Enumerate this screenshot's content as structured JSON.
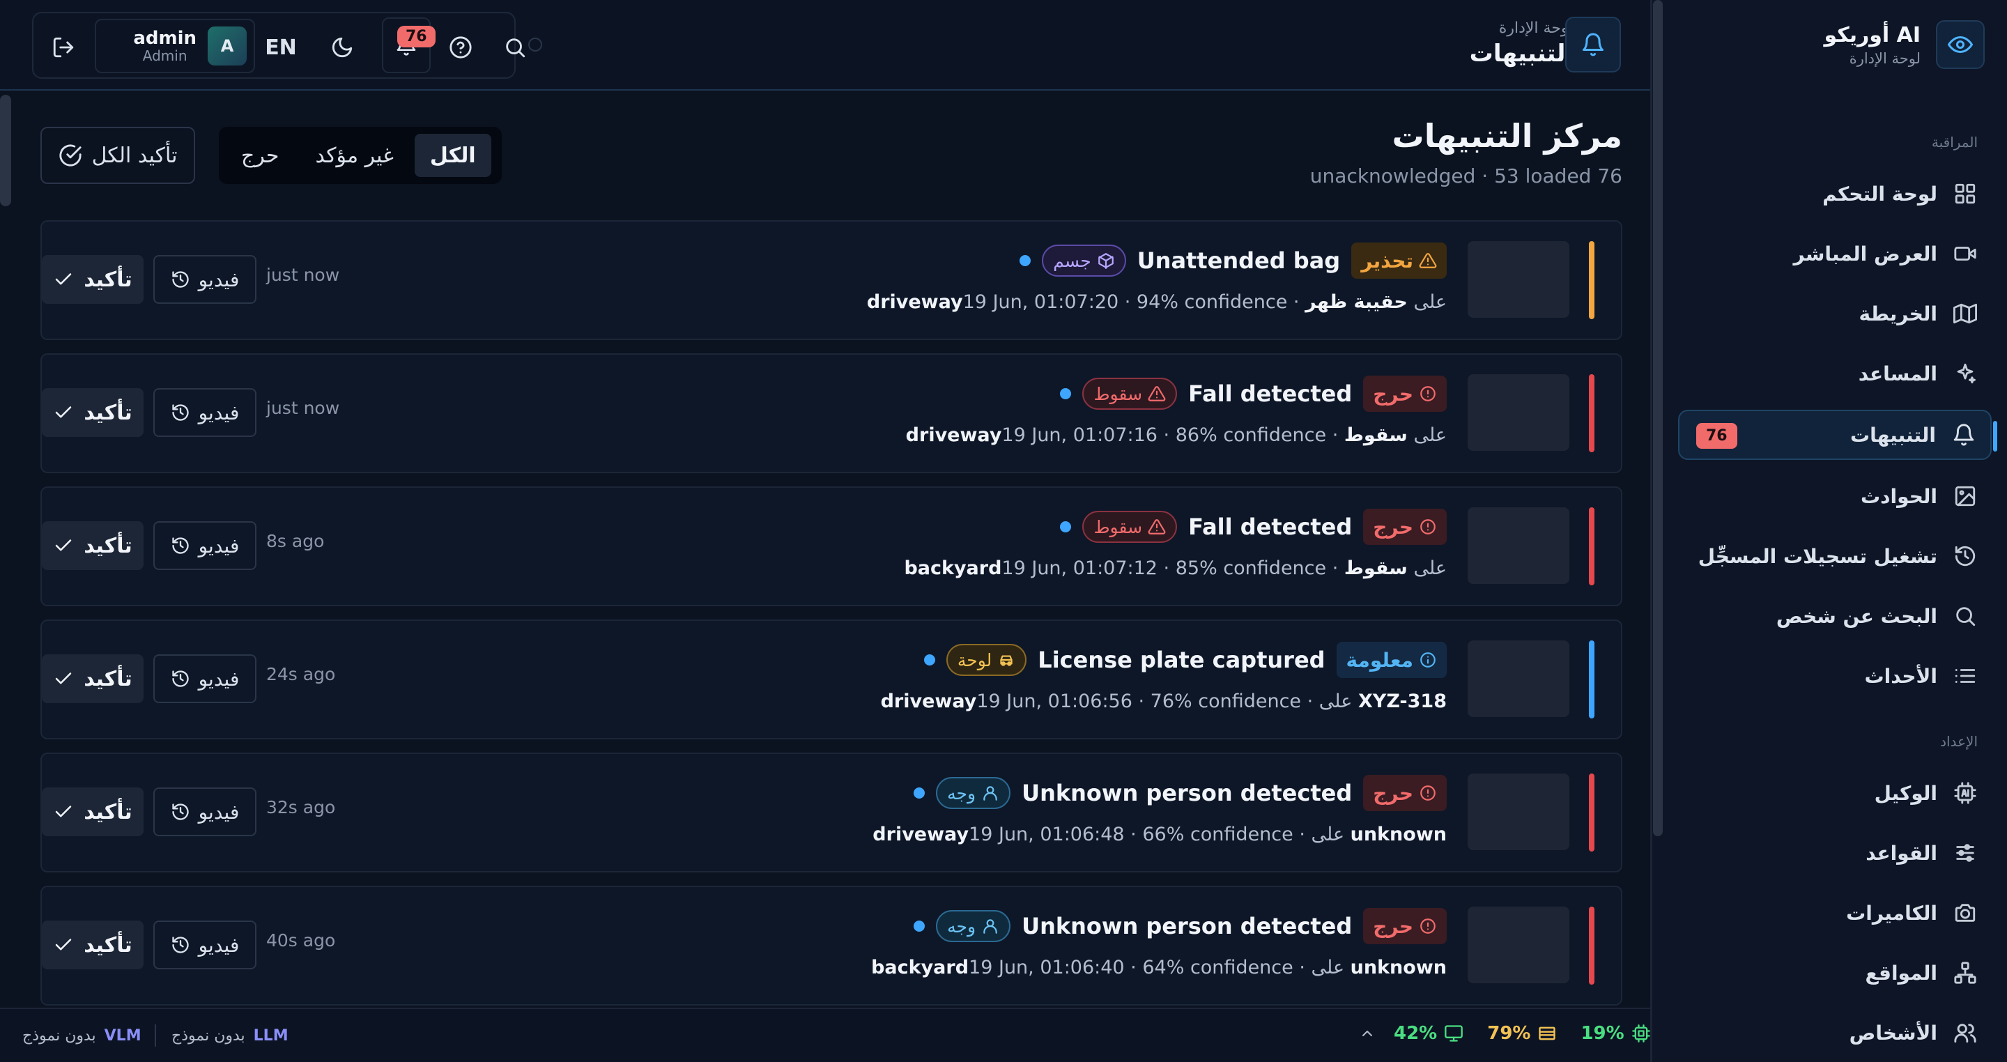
{
  "sidebar": {
    "brand_name": "أوريكو AI",
    "brand_sub": "لوحة الإدارة",
    "sections": {
      "monitoring": "المراقبة",
      "setup": "الإعداد"
    },
    "items": [
      {
        "label": "لوحة التحكم",
        "icon": "grid-icon"
      },
      {
        "label": "العرض المباشر",
        "icon": "video-icon"
      },
      {
        "label": "الخريطة",
        "icon": "map-icon"
      },
      {
        "label": "المساعد",
        "icon": "sparkle-icon"
      },
      {
        "label": "التنبيهات",
        "icon": "bell-icon",
        "badge": "76",
        "active": true
      },
      {
        "label": "الحوادث",
        "icon": "image-icon"
      },
      {
        "label": "تشغيل تسجيلات المسجِّل",
        "icon": "history-icon"
      },
      {
        "label": "البحث عن شخص",
        "icon": "search-icon"
      },
      {
        "label": "الأحداث",
        "icon": "list-icon"
      },
      {
        "label": "الوكيل",
        "icon": "ai-chip-icon"
      },
      {
        "label": "القواعد",
        "icon": "sliders-icon"
      },
      {
        "label": "الكاميرات",
        "icon": "camera-icon"
      },
      {
        "label": "المواقع",
        "icon": "network-icon"
      },
      {
        "label": "الأشخاص",
        "icon": "users-icon"
      }
    ]
  },
  "header": {
    "breadcrumb": "لوحة الإدارة",
    "title": "التنبيهات",
    "user_name": "admin",
    "user_role": "Admin",
    "avatar_letter": "A",
    "language": "EN",
    "notification_count": "76"
  },
  "main": {
    "title": "مركز التنبيهات",
    "subtitle": "unacknowledged · 53 loaded 76",
    "confirm_all_label": "تأكيد الكل",
    "filters": [
      {
        "label": "الكل",
        "active": true
      },
      {
        "label": "غير مؤكد",
        "active": false
      },
      {
        "label": "حرج",
        "active": false
      }
    ],
    "video_label": "فيديو",
    "ack_label": "تأكيد",
    "alerts": [
      {
        "severity": "تحذير",
        "severity_kind": "warning",
        "bar_color": "#f3a640",
        "title": "Unattended bag",
        "type": "جسم",
        "type_kind": "object",
        "subject": "حقيبة ظهر",
        "on": "على",
        "details": "19 Jun, 01:07:20 · 94% confidence · ",
        "location": "driveway",
        "time": "just now"
      },
      {
        "severity": "حرج",
        "severity_kind": "critical",
        "bar_color": "#e5484d",
        "title": "Fall detected",
        "type": "سقوط",
        "type_kind": "fall",
        "subject": "سقوط",
        "on": "على",
        "details": "19 Jun, 01:07:16 · 86% confidence · ",
        "location": "driveway",
        "time": "just now"
      },
      {
        "severity": "حرج",
        "severity_kind": "critical",
        "bar_color": "#e5484d",
        "title": "Fall detected",
        "type": "سقوط",
        "type_kind": "fall",
        "subject": "سقوط",
        "on": "على",
        "details": "19 Jun, 01:07:12 · 85% confidence · ",
        "location": "backyard",
        "time": "8s ago"
      },
      {
        "severity": "معلومة",
        "severity_kind": "info",
        "bar_color": "#3ea6ff",
        "title": "License plate captured",
        "type": "لوحة",
        "type_kind": "plate",
        "subject": "XYZ-318",
        "on": "على",
        "details": "19 Jun, 01:06:56 · 76% confidence · ",
        "location": "driveway",
        "time": "24s ago"
      },
      {
        "severity": "حرج",
        "severity_kind": "critical",
        "bar_color": "#e5484d",
        "title": "Unknown person detected",
        "type": "وجه",
        "type_kind": "face",
        "subject": "unknown",
        "on": "على",
        "details": "19 Jun, 01:06:48 · 66% confidence · ",
        "location": "driveway",
        "time": "32s ago"
      },
      {
        "severity": "حرج",
        "severity_kind": "critical",
        "bar_color": "#e5484d",
        "title": "Unknown person detected",
        "type": "وجه",
        "type_kind": "face",
        "subject": "unknown",
        "on": "على",
        "details": "19 Jun, 01:06:40 · 64% confidence · ",
        "location": "backyard",
        "time": "40s ago"
      }
    ]
  },
  "footer": {
    "vlm_tag": "VLM",
    "vlm_text": "بدون نموذج",
    "llm_tag": "LLM",
    "llm_text": "بدون نموذج",
    "stats": [
      {
        "value": "42%",
        "icon": "monitor-icon",
        "color": "#4ade80"
      },
      {
        "value": "79%",
        "icon": "memory-icon",
        "color": "#f3c254"
      },
      {
        "value": "19%",
        "icon": "cpu-icon",
        "color": "#4ade80"
      }
    ]
  }
}
